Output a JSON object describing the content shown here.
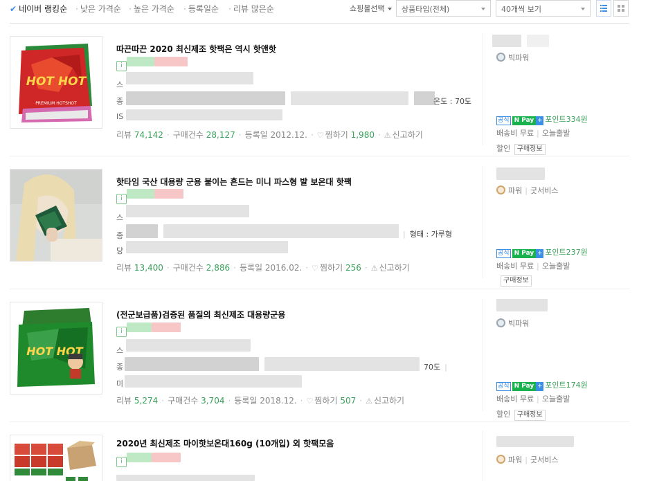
{
  "sort": {
    "options": [
      "네이버 랭킹순",
      "낮은 가격순",
      "높은 가격순",
      "등록일순",
      "리뷰 많은순"
    ],
    "shop_select": "쇼핑몰선택",
    "product_type": "상품타입(전체)",
    "per_page": "40개씩 보기"
  },
  "products": [
    {
      "title": "따끈따끈 2020 최신제조 핫팩은 역시 핫앤핫",
      "spec_initials": [
        "스",
        "종",
        "IS"
      ],
      "spec_tail": "온도 : 70도",
      "review_label": "리뷰",
      "review_count": "74,142",
      "purchase_label": "구매건수",
      "purchase_count": "28,127",
      "reg_label": "등록일 2012.12.",
      "like_label": "찜하기",
      "like_count": "1,980",
      "report_label": "신고하기",
      "grade": "빅파워",
      "service": "",
      "official": "공식",
      "npay": "N Pay",
      "point": "포인트334원",
      "shipping": "배송비 무료",
      "delivery": "오늘출발",
      "discount": "할인",
      "purchase_info": "구매정보"
    },
    {
      "title": "핫타임 국산 대용량 군용 붙이는 흔드는 미니 파스형 발 보온대 핫팩",
      "spec_initials": [
        "스",
        "종",
        "당"
      ],
      "spec_tail": "형태 : 가루형",
      "review_label": "리뷰",
      "review_count": "13,400",
      "purchase_label": "구매건수",
      "purchase_count": "2,886",
      "reg_label": "등록일 2016.02.",
      "like_label": "찜하기",
      "like_count": "256",
      "report_label": "신고하기",
      "grade": "파워",
      "service": "굿서비스",
      "official": "공식",
      "npay": "N Pay",
      "point": "포인트237원",
      "shipping": "배송비 무료",
      "delivery": "오늘출발",
      "discount": "",
      "purchase_info": "구매정보"
    },
    {
      "title": "(전군보급품)검증된 품질의 최신제조 대용량군용",
      "spec_initials": [
        "스",
        "종",
        "미"
      ],
      "spec_tail": "70도",
      "review_label": "리뷰",
      "review_count": "5,274",
      "purchase_label": "구매건수",
      "purchase_count": "3,704",
      "reg_label": "등록일 2018.12.",
      "like_label": "찜하기",
      "like_count": "507",
      "report_label": "신고하기",
      "grade": "빅파워",
      "service": "",
      "official": "공식",
      "npay": "N Pay",
      "point": "포인트174원",
      "shipping": "배송비 무료",
      "delivery": "오늘출발",
      "discount": "할인",
      "purchase_info": "구매정보"
    },
    {
      "title": "2020년 최신제조 마이핫보온대160g (10개입) 외 핫팩모음",
      "grade": "파워",
      "service": "굿서비스"
    }
  ],
  "thumb_labels": {
    "hot_hot": "HOT HOT",
    "premium": "PREMIUM HOTSHOT"
  },
  "colors": {
    "accent_green": "#3aa15a",
    "npay_green": "#19b24f",
    "link_blue": "#3a8ee6"
  }
}
